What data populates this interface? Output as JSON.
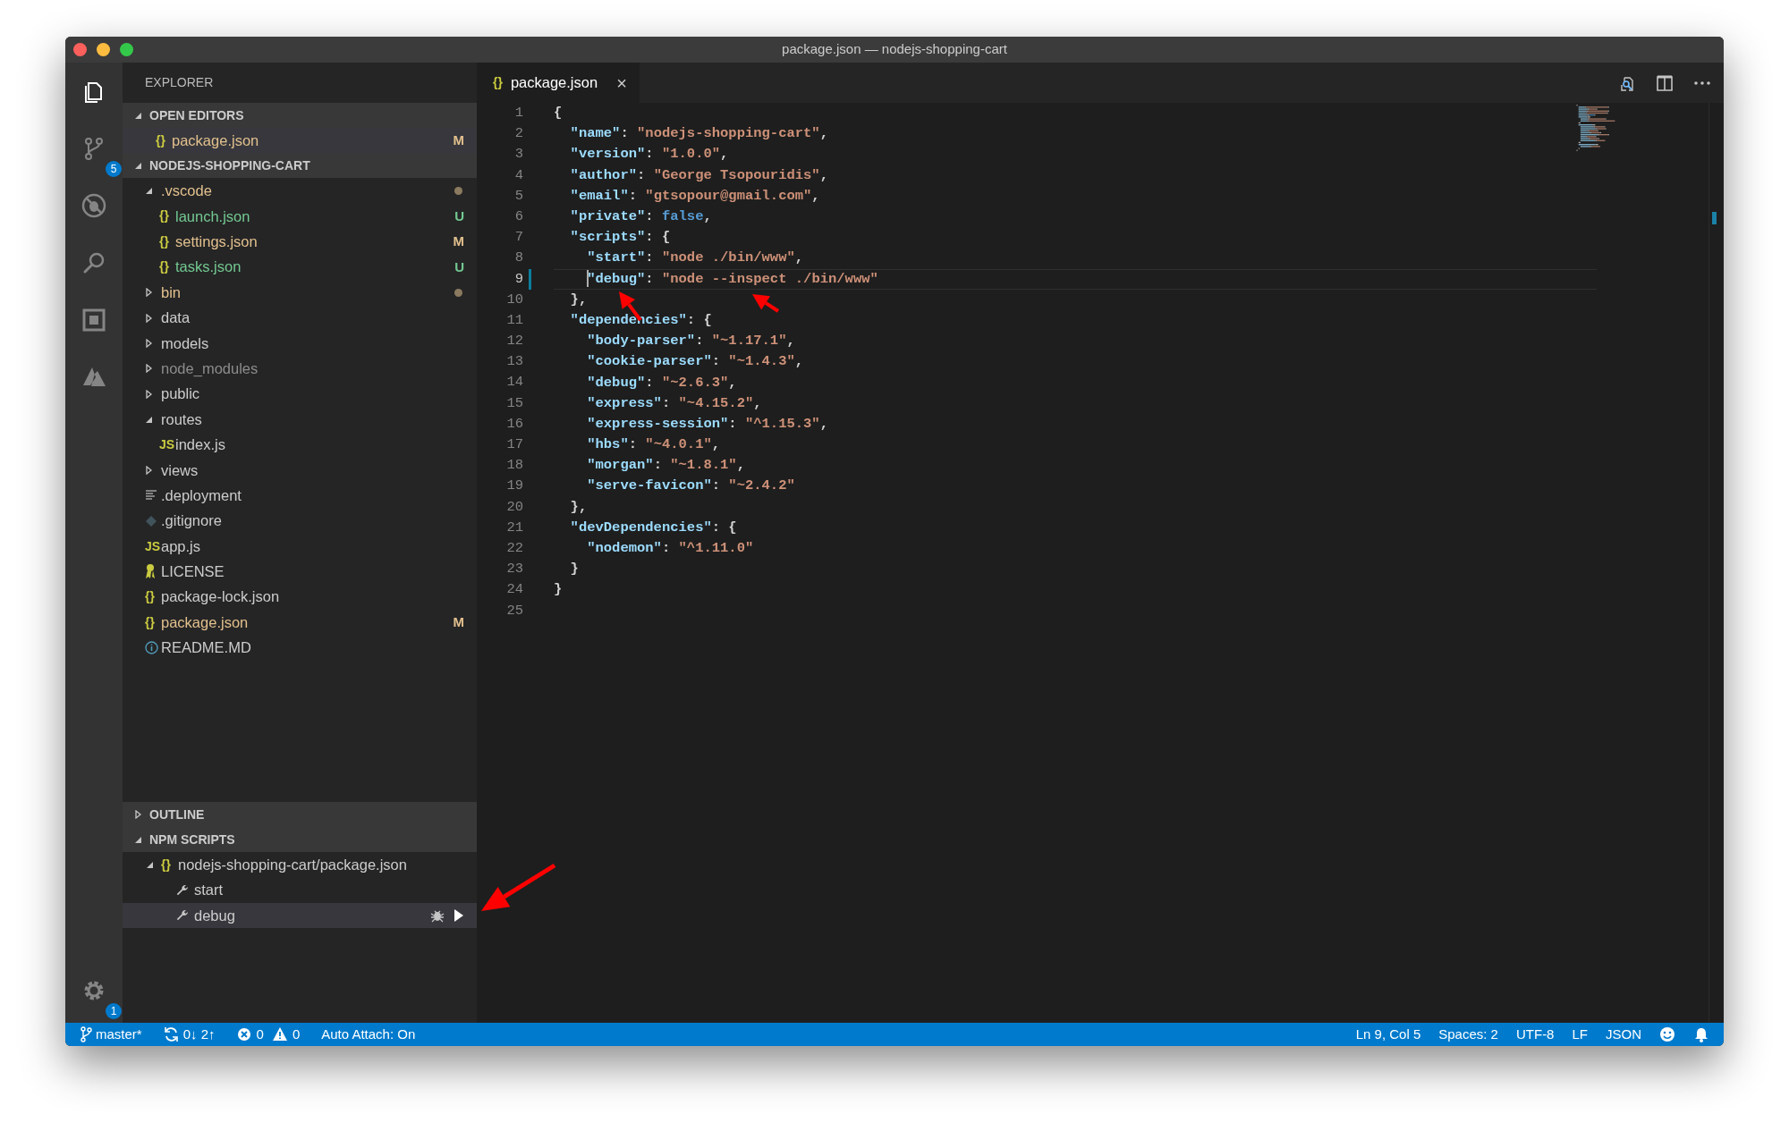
{
  "window": {
    "title": "package.json — nodejs-shopping-cart"
  },
  "activity_bar": {
    "items": [
      {
        "kind": "files",
        "selected": true
      },
      {
        "kind": "source-control",
        "selected": false,
        "badge": "5"
      },
      {
        "kind": "debug",
        "selected": false
      },
      {
        "kind": "search",
        "selected": false
      },
      {
        "kind": "extensions",
        "selected": false
      },
      {
        "kind": "azure",
        "selected": false
      }
    ],
    "bottom": [
      {
        "kind": "settings",
        "badge": "1"
      }
    ]
  },
  "sidebar": {
    "title": "EXPLORER",
    "open_editors": {
      "title": "OPEN EDITORS",
      "expanded": true,
      "items": [
        {
          "label": "package.json",
          "kind": "file",
          "icon": {
            "kind": "glyph",
            "text": "{}"
          },
          "color": "#e2c08d",
          "decoration": "M",
          "selected": true
        }
      ]
    },
    "project": {
      "title": "NODEJS-SHOPPING-CART",
      "expanded": true,
      "items": [
        {
          "label": ".vscode",
          "kind": "folder",
          "expanded": true,
          "color": "#e2c08d",
          "dot": true,
          "children": [
            {
              "label": "launch.json",
              "kind": "file",
              "icon": {
                "kind": "glyph",
                "text": "{}"
              },
              "color": "#73c991",
              "decoration": "U"
            },
            {
              "label": "settings.json",
              "kind": "file",
              "icon": {
                "kind": "glyph",
                "text": "{}"
              },
              "color": "#e2c08d",
              "decoration": "M"
            },
            {
              "label": "tasks.json",
              "kind": "file",
              "icon": {
                "kind": "glyph",
                "text": "{}"
              },
              "color": "#73c991",
              "decoration": "U"
            }
          ]
        },
        {
          "label": "bin",
          "kind": "folder",
          "expanded": false,
          "color": "#e2c08d",
          "dot": true
        },
        {
          "label": "data",
          "kind": "folder",
          "expanded": false
        },
        {
          "label": "models",
          "kind": "folder",
          "expanded": false
        },
        {
          "label": "node_modules",
          "kind": "folder",
          "expanded": false,
          "color": "#8c8c8c"
        },
        {
          "label": "public",
          "kind": "folder",
          "expanded": false
        },
        {
          "label": "routes",
          "kind": "folder",
          "expanded": true,
          "children": [
            {
              "label": "index.js",
              "kind": "file",
              "icon": {
                "kind": "glyph",
                "text": "JS"
              }
            }
          ]
        },
        {
          "label": "views",
          "kind": "folder",
          "expanded": false
        },
        {
          "label": ".deployment",
          "kind": "file",
          "icon": {
            "kind": "lines"
          }
        },
        {
          "label": ".gitignore",
          "kind": "file",
          "icon": {
            "kind": "git"
          }
        },
        {
          "label": "app.js",
          "kind": "file",
          "icon": {
            "kind": "glyph",
            "text": "JS"
          }
        },
        {
          "label": "LICENSE",
          "kind": "file",
          "icon": {
            "kind": "license"
          }
        },
        {
          "label": "package-lock.json",
          "kind": "file",
          "icon": {
            "kind": "glyph",
            "text": "{}"
          }
        },
        {
          "label": "package.json",
          "kind": "file",
          "icon": {
            "kind": "glyph",
            "text": "{}"
          },
          "color": "#e2c08d",
          "decoration": "M"
        },
        {
          "label": "README.MD",
          "kind": "file",
          "icon": {
            "kind": "info"
          }
        }
      ]
    },
    "outline": {
      "title": "OUTLINE",
      "expanded": false
    },
    "npm_scripts": {
      "title": "NPM SCRIPTS",
      "expanded": true,
      "items": [
        {
          "label": "nodejs-shopping-cart/package.json",
          "icon": {
            "kind": "glyph",
            "text": "{}"
          },
          "expanded": true,
          "children": [
            {
              "label": "start",
              "selected": false
            },
            {
              "label": "debug",
              "selected": true
            }
          ]
        }
      ]
    }
  },
  "tabs": [
    {
      "label": "package.json",
      "icon": {
        "kind": "glyph",
        "text": "{}"
      },
      "close": "×",
      "selected": true
    }
  ],
  "editor_actions": [
    {
      "kind": "open-preview"
    },
    {
      "kind": "split"
    },
    {
      "kind": "more"
    }
  ],
  "editor": {
    "lines": [
      {
        "number": "1",
        "current": false,
        "changed": false,
        "tokens": [
          {
            "kind": "punct",
            "text": "{"
          }
        ]
      },
      {
        "number": "2",
        "current": false,
        "changed": false,
        "tokens": [
          {
            "kind": "key",
            "text": "  \"name\""
          },
          {
            "kind": "punct",
            "text": ": "
          },
          {
            "kind": "string",
            "text": "\"nodejs-shopping-cart\""
          },
          {
            "kind": "punct",
            "text": ","
          }
        ]
      },
      {
        "number": "3",
        "current": false,
        "changed": false,
        "tokens": [
          {
            "kind": "key",
            "text": "  \"version\""
          },
          {
            "kind": "punct",
            "text": ": "
          },
          {
            "kind": "string",
            "text": "\"1.0.0\""
          },
          {
            "kind": "punct",
            "text": ","
          }
        ]
      },
      {
        "number": "4",
        "current": false,
        "changed": false,
        "tokens": [
          {
            "kind": "key",
            "text": "  \"author\""
          },
          {
            "kind": "punct",
            "text": ": "
          },
          {
            "kind": "string",
            "text": "\"George Tsopouridis\""
          },
          {
            "kind": "punct",
            "text": ","
          }
        ]
      },
      {
        "number": "5",
        "current": false,
        "changed": false,
        "tokens": [
          {
            "kind": "key",
            "text": "  \"email\""
          },
          {
            "kind": "punct",
            "text": ": "
          },
          {
            "kind": "string",
            "text": "\"gtsopour@gmail.com\""
          },
          {
            "kind": "punct",
            "text": ","
          }
        ]
      },
      {
        "number": "6",
        "current": false,
        "changed": false,
        "tokens": [
          {
            "kind": "key",
            "text": "  \"private\""
          },
          {
            "kind": "punct",
            "text": ": "
          },
          {
            "kind": "bool",
            "text": "false"
          },
          {
            "kind": "punct",
            "text": ","
          }
        ]
      },
      {
        "number": "7",
        "current": false,
        "changed": false,
        "tokens": [
          {
            "kind": "key",
            "text": "  \"scripts\""
          },
          {
            "kind": "punct",
            "text": ": {"
          }
        ]
      },
      {
        "number": "8",
        "current": false,
        "changed": false,
        "tokens": [
          {
            "kind": "key",
            "text": "    \"start\""
          },
          {
            "kind": "punct",
            "text": ": "
          },
          {
            "kind": "string",
            "text": "\"node ./bin/www\""
          },
          {
            "kind": "punct",
            "text": ","
          }
        ]
      },
      {
        "number": "9",
        "current": true,
        "changed": true,
        "tokens": [
          {
            "kind": "key",
            "text": "    \"debug\""
          },
          {
            "kind": "punct",
            "text": ": "
          },
          {
            "kind": "string",
            "text": "\"node --inspect ./bin/www\""
          }
        ]
      },
      {
        "number": "10",
        "current": false,
        "changed": false,
        "tokens": [
          {
            "kind": "punct",
            "text": "  },"
          }
        ]
      },
      {
        "number": "11",
        "current": false,
        "changed": false,
        "tokens": [
          {
            "kind": "key",
            "text": "  \"dependencies\""
          },
          {
            "kind": "punct",
            "text": ": {"
          }
        ]
      },
      {
        "number": "12",
        "current": false,
        "changed": false,
        "tokens": [
          {
            "kind": "key",
            "text": "    \"body-parser\""
          },
          {
            "kind": "punct",
            "text": ": "
          },
          {
            "kind": "string",
            "text": "\"~1.17.1\""
          },
          {
            "kind": "punct",
            "text": ","
          }
        ]
      },
      {
        "number": "13",
        "current": false,
        "changed": false,
        "tokens": [
          {
            "kind": "key",
            "text": "    \"cookie-parser\""
          },
          {
            "kind": "punct",
            "text": ": "
          },
          {
            "kind": "string",
            "text": "\"~1.4.3\""
          },
          {
            "kind": "punct",
            "text": ","
          }
        ]
      },
      {
        "number": "14",
        "current": false,
        "changed": false,
        "tokens": [
          {
            "kind": "key",
            "text": "    \"debug\""
          },
          {
            "kind": "punct",
            "text": ": "
          },
          {
            "kind": "string",
            "text": "\"~2.6.3\""
          },
          {
            "kind": "punct",
            "text": ","
          }
        ]
      },
      {
        "number": "15",
        "current": false,
        "changed": false,
        "tokens": [
          {
            "kind": "key",
            "text": "    \"express\""
          },
          {
            "kind": "punct",
            "text": ": "
          },
          {
            "kind": "string",
            "text": "\"~4.15.2\""
          },
          {
            "kind": "punct",
            "text": ","
          }
        ]
      },
      {
        "number": "16",
        "current": false,
        "changed": false,
        "tokens": [
          {
            "kind": "key",
            "text": "    \"express-session\""
          },
          {
            "kind": "punct",
            "text": ": "
          },
          {
            "kind": "string",
            "text": "\"^1.15.3\""
          },
          {
            "kind": "punct",
            "text": ","
          }
        ]
      },
      {
        "number": "17",
        "current": false,
        "changed": false,
        "tokens": [
          {
            "kind": "key",
            "text": "    \"hbs\""
          },
          {
            "kind": "punct",
            "text": ": "
          },
          {
            "kind": "string",
            "text": "\"~4.0.1\""
          },
          {
            "kind": "punct",
            "text": ","
          }
        ]
      },
      {
        "number": "18",
        "current": false,
        "changed": false,
        "tokens": [
          {
            "kind": "key",
            "text": "    \"morgan\""
          },
          {
            "kind": "punct",
            "text": ": "
          },
          {
            "kind": "string",
            "text": "\"~1.8.1\""
          },
          {
            "kind": "punct",
            "text": ","
          }
        ]
      },
      {
        "number": "19",
        "current": false,
        "changed": false,
        "tokens": [
          {
            "kind": "key",
            "text": "    \"serve-favicon\""
          },
          {
            "kind": "punct",
            "text": ": "
          },
          {
            "kind": "string",
            "text": "\"~2.4.2\""
          }
        ]
      },
      {
        "number": "20",
        "current": false,
        "changed": false,
        "tokens": [
          {
            "kind": "punct",
            "text": "  },"
          }
        ]
      },
      {
        "number": "21",
        "current": false,
        "changed": false,
        "tokens": [
          {
            "kind": "key",
            "text": "  \"devDependencies\""
          },
          {
            "kind": "punct",
            "text": ": {"
          }
        ]
      },
      {
        "number": "22",
        "current": false,
        "changed": false,
        "tokens": [
          {
            "kind": "key",
            "text": "    \"nodemon\""
          },
          {
            "kind": "punct",
            "text": ": "
          },
          {
            "kind": "string",
            "text": "\"^1.11.0\""
          }
        ]
      },
      {
        "number": "23",
        "current": false,
        "changed": false,
        "tokens": [
          {
            "kind": "punct",
            "text": "  }"
          }
        ]
      },
      {
        "number": "24",
        "current": false,
        "changed": false,
        "tokens": [
          {
            "kind": "punct",
            "text": "}"
          }
        ]
      },
      {
        "number": "25",
        "current": false,
        "changed": false
      }
    ]
  },
  "status_bar": {
    "left": [
      {
        "kind": "branch",
        "text": "master*"
      },
      {
        "kind": "sync",
        "text": "0↓ 2↑"
      },
      {
        "kind": "errors",
        "text": "0"
      },
      {
        "kind": "warnings",
        "text": "0"
      },
      {
        "kind": "plain",
        "text": "Auto Attach: On"
      }
    ],
    "right": [
      {
        "kind": "plain",
        "text": "Ln 9, Col 5"
      },
      {
        "kind": "plain",
        "text": "Spaces: 2"
      },
      {
        "kind": "plain",
        "text": "UTF-8"
      },
      {
        "kind": "plain",
        "text": "LF"
      },
      {
        "kind": "plain",
        "text": "JSON"
      },
      {
        "kind": "feedback"
      },
      {
        "kind": "bell"
      }
    ]
  },
  "annotations": [
    {
      "kind": "arrow"
    },
    {
      "kind": "arrow"
    },
    {
      "kind": "arrow"
    }
  ]
}
